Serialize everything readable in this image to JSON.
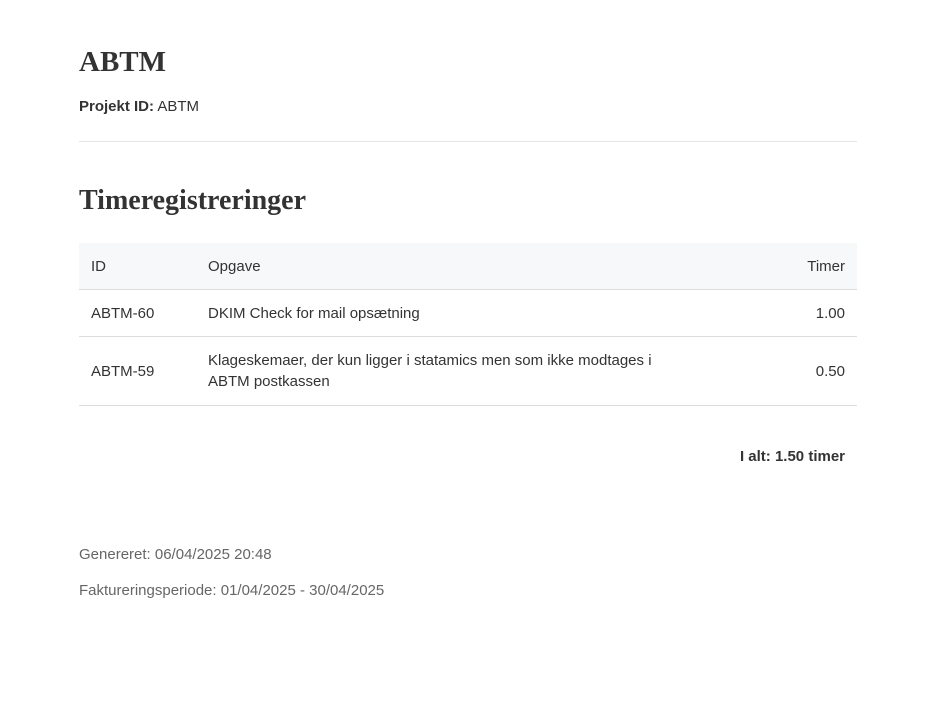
{
  "project": {
    "title": "ABTM",
    "id_label": "Projekt ID:",
    "id_value": "ABTM"
  },
  "section": {
    "title": "Timeregistreringer"
  },
  "table": {
    "headers": {
      "id": "ID",
      "task": "Opgave",
      "hours": "Timer"
    },
    "rows": [
      {
        "id": "ABTM-60",
        "task": "DKIM Check for mail opsætning",
        "hours": "1.00"
      },
      {
        "id": "ABTM-59",
        "task": "Klageskemaer, der kun ligger i statamics men som ikke modtages i ABTM postkassen",
        "hours": "0.50"
      }
    ]
  },
  "summary": {
    "total": "I alt: 1.50 timer"
  },
  "footer": {
    "generated": "Genereret: 06/04/2025 20:48",
    "period": "Faktureringsperiode: 01/04/2025 - 30/04/2025"
  },
  "colors": {
    "text": "#333333",
    "muted": "#666666",
    "header_bg": "#f7f8f9",
    "border": "#dddddd"
  }
}
